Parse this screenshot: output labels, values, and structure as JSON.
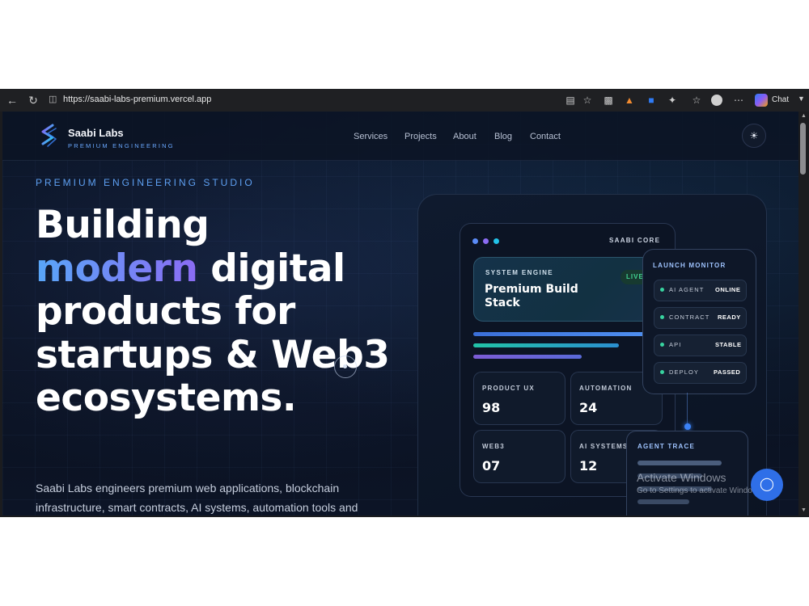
{
  "browser": {
    "url": "https://saabi-labs-premium.vercel.app",
    "chat_label": "Chat"
  },
  "header": {
    "brand_name": "Saabi Labs",
    "brand_sub": "PREMIUM ENGINEERING",
    "nav": [
      "Services",
      "Projects",
      "About",
      "Blog",
      "Contact"
    ]
  },
  "hero": {
    "eyebrow": "PREMIUM ENGINEERING STUDIO",
    "headline_1": "Building",
    "headline_accent": "modern",
    "headline_2": " digital products for startups & Web3 ecosystems.",
    "lede": "Saabi Labs engineers premium web applications, blockchain infrastructure, smart contracts, AI systems, automation tools and"
  },
  "showcase": {
    "core_label": "SAABI CORE",
    "engine_label": "SYSTEM ENGINE",
    "engine_title": "Premium Build Stack",
    "live_label": "LIVE",
    "stats": [
      {
        "label": "PRODUCT UX",
        "value": "98"
      },
      {
        "label": "AUTOMATION",
        "value": "24"
      },
      {
        "label": "WEB3",
        "value": "07"
      },
      {
        "label": "AI SYSTEMS",
        "value": "12"
      }
    ],
    "monitor": {
      "title": "LAUNCH MONITOR",
      "rows": [
        {
          "key": "AI AGENT",
          "value": "ONLINE"
        },
        {
          "key": "CONTRACT",
          "value": "READY"
        },
        {
          "key": "API",
          "value": "STABLE"
        },
        {
          "key": "DEPLOY",
          "value": "PASSED"
        }
      ]
    },
    "trace_title": "AGENT TRACE"
  },
  "overlay": {
    "activate_title": "Activate Windows",
    "activate_sub": "Go to Settings to activate Windows."
  },
  "colors": {
    "accent_blue": "#58a6f8",
    "accent_purple": "#8b6cf3",
    "status_green": "#38d39f",
    "background": "#0a1425"
  }
}
